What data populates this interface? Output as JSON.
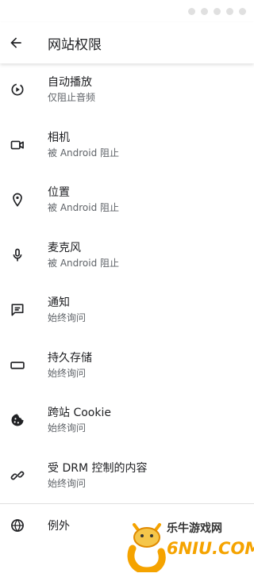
{
  "header": {
    "title": "网站权限"
  },
  "items": [
    {
      "icon": "autoplay-icon",
      "title": "自动播放",
      "subtitle": "仅阻止音频"
    },
    {
      "icon": "camera-icon",
      "title": "相机",
      "subtitle": "被 Android 阻止"
    },
    {
      "icon": "location-icon",
      "title": "位置",
      "subtitle": "被 Android 阻止"
    },
    {
      "icon": "microphone-icon",
      "title": "麦克风",
      "subtitle": "被 Android 阻止"
    },
    {
      "icon": "notification-icon",
      "title": "通知",
      "subtitle": "始终询问"
    },
    {
      "icon": "storage-icon",
      "title": "持久存储",
      "subtitle": "始终询问"
    },
    {
      "icon": "cookie-icon",
      "title": "跨站 Cookie",
      "subtitle": "始终询问"
    },
    {
      "icon": "drm-icon",
      "title": "受 DRM 控制的内容",
      "subtitle": "始终询问"
    }
  ],
  "exceptions": {
    "icon": "globe-icon",
    "label": "例外"
  },
  "watermark": {
    "text": "乐牛游戏网",
    "brand": "6NIU.COM"
  }
}
